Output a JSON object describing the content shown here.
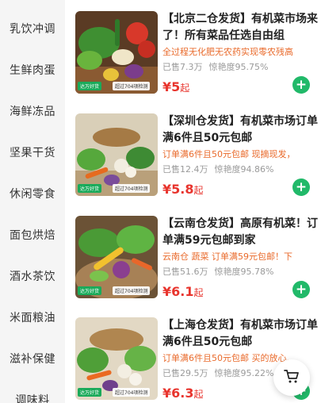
{
  "sidebar": {
    "categories": [
      {
        "label": "乳饮冲调"
      },
      {
        "label": "生鲜肉蛋"
      },
      {
        "label": "海鲜冻品"
      },
      {
        "label": "坚果干货"
      },
      {
        "label": "休闲零食"
      },
      {
        "label": "面包烘焙"
      },
      {
        "label": "酒水茶饮"
      },
      {
        "label": "米面粮油"
      },
      {
        "label": "滋补保健"
      },
      {
        "label": "调味料"
      }
    ]
  },
  "products": [
    {
      "title": "【北京二仓发货】有机菜市场来了！所有菜品任选自由组",
      "subtitle": "全过程无化肥无农药实现零农残高",
      "sold": "已售7.3万",
      "rating": "惊艳度95.75%",
      "price_symbol": "¥",
      "price": "5",
      "price_unit": "起",
      "badge_tag": "达万好货",
      "badge_text": "超过704项检测"
    },
    {
      "title": "【深圳仓发货】有机菜市场订单满6件且50元包邮",
      "subtitle": "订单满6件且50元包邮 现摘现发，",
      "sold": "已售12.4万",
      "rating": "惊艳度94.86%",
      "price_symbol": "¥",
      "price": "5.8",
      "price_unit": "起",
      "badge_tag": "达万好货",
      "badge_text": "超过704项检测"
    },
    {
      "title": "【云南仓发货】高原有机菜！订单满59元包邮到家",
      "subtitle": "云南仓 蔬菜 订单满59元包邮！下",
      "sold": "已售51.6万",
      "rating": "惊艳度95.78%",
      "price_symbol": "¥",
      "price": "6.1",
      "price_unit": "起",
      "badge_tag": "达万好货",
      "badge_text": "超过704项检测"
    },
    {
      "title": "【上海仓发货】有机菜市场订单满6件且50元包邮",
      "subtitle": "订单满6件且50元包邮 买的放心,",
      "sold": "已售29.5万",
      "rating": "惊艳度95.22%",
      "price_symbol": "¥",
      "price": "6.3",
      "price_unit": "起",
      "badge_tag": "达万好货",
      "badge_text": "超过704项检测"
    }
  ],
  "icons": {
    "add": "plus-icon",
    "cart": "shopping-cart-icon"
  },
  "colors": {
    "accent_green": "#21b969",
    "price_red": "#e8342d",
    "subtitle_orange": "#e96a2b"
  }
}
